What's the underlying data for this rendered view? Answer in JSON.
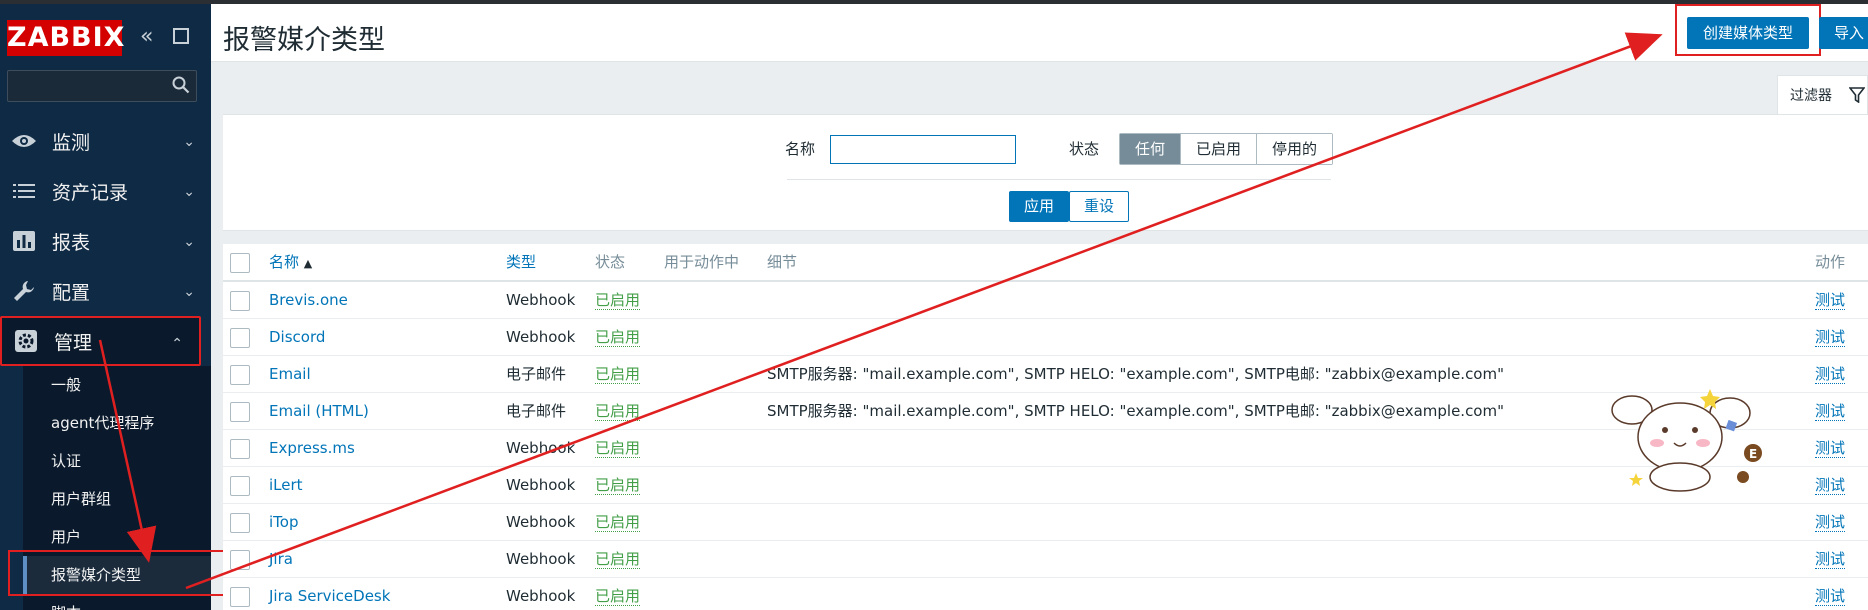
{
  "app": {
    "logo": "ZABBIX"
  },
  "sidebar": {
    "collapse_glyph": "«",
    "menu": [
      {
        "label": "监测",
        "icon": "eye-icon"
      },
      {
        "label": "资产记录",
        "icon": "list-icon"
      },
      {
        "label": "报表",
        "icon": "bar-chart-icon"
      },
      {
        "label": "配置",
        "icon": "wrench-icon"
      },
      {
        "label": "管理",
        "icon": "gear-icon",
        "active": true
      }
    ],
    "submenu": [
      {
        "label": "一般"
      },
      {
        "label": "agent代理程序"
      },
      {
        "label": "认证"
      },
      {
        "label": "用户群组"
      },
      {
        "label": "用户"
      },
      {
        "label": "报警媒介类型",
        "active": true
      },
      {
        "label": "脚本"
      }
    ]
  },
  "header": {
    "title": "报警媒介类型",
    "create_label": "创建媒体类型",
    "import_label": "导入"
  },
  "filter": {
    "tab_label": "过滤器",
    "name_label": "名称",
    "name_value": "",
    "status_label": "状态",
    "status_options": [
      "任何",
      "已启用",
      "停用的"
    ],
    "status_selected": "任何",
    "apply_label": "应用",
    "reset_label": "重设"
  },
  "table": {
    "headers": {
      "name": "名称",
      "sort_indicator": "▲",
      "type": "类型",
      "status": "状态",
      "used_in_actions": "用于动作中",
      "details": "细节",
      "action": "动作"
    },
    "rows": [
      {
        "name": "Brevis.one",
        "type": "Webhook",
        "status": "已启用",
        "details": "",
        "action": "测试"
      },
      {
        "name": "Discord",
        "type": "Webhook",
        "status": "已启用",
        "details": "",
        "action": "测试"
      },
      {
        "name": "Email",
        "type": "电子邮件",
        "status": "已启用",
        "details": "SMTP服务器: \"mail.example.com\", SMTP HELO: \"example.com\", SMTP电邮: \"zabbix@example.com\"",
        "action": "测试"
      },
      {
        "name": "Email (HTML)",
        "type": "电子邮件",
        "status": "已启用",
        "details": "SMTP服务器: \"mail.example.com\", SMTP HELO: \"example.com\", SMTP电邮: \"zabbix@example.com\"",
        "action": "测试"
      },
      {
        "name": "Express.ms",
        "type": "Webhook",
        "status": "已启用",
        "details": "",
        "action": "测试"
      },
      {
        "name": "iLert",
        "type": "Webhook",
        "status": "已启用",
        "details": "",
        "action": "测试"
      },
      {
        "name": "iTop",
        "type": "Webhook",
        "status": "已启用",
        "details": "",
        "action": "测试"
      },
      {
        "name": "Jira",
        "type": "Webhook",
        "status": "已启用",
        "details": "",
        "action": "测试"
      },
      {
        "name": "Jira ServiceDesk",
        "type": "Webhook",
        "status": "已启用",
        "details": "",
        "action": "测试"
      }
    ]
  },
  "colors": {
    "sidebar_bg": "#0f2a44",
    "accent": "#0275b8",
    "enabled": "#429e47",
    "annotation": "#e02020",
    "logo_bg": "#d40000"
  }
}
